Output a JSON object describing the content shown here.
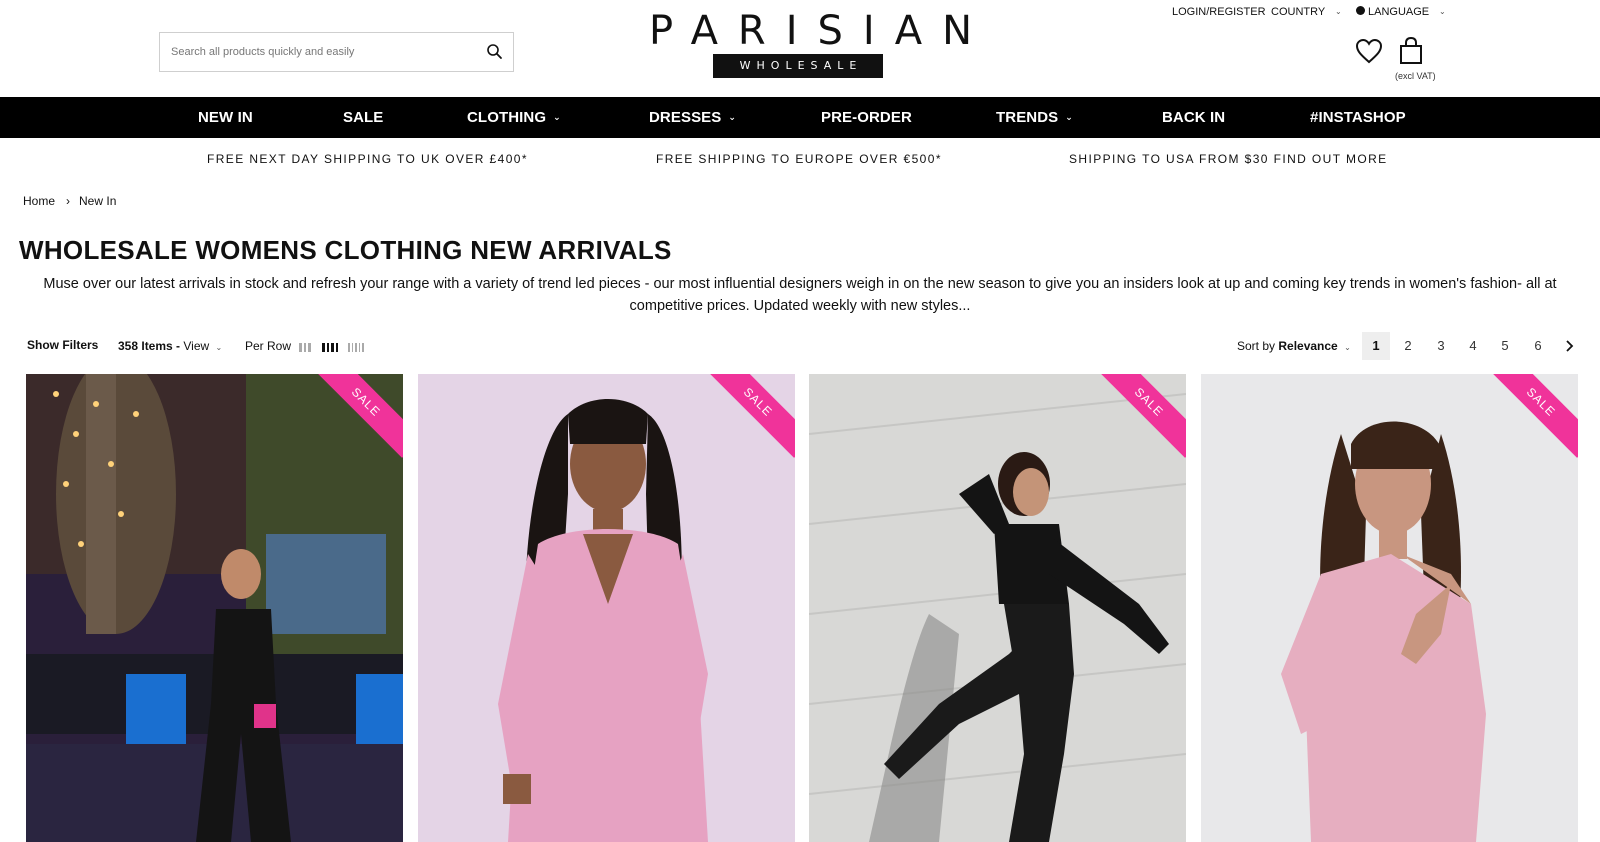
{
  "search": {
    "placeholder": "Search all products quickly and easily"
  },
  "logo": {
    "top": "PARISIAN",
    "bottom": "WHOLESALE"
  },
  "top_links": {
    "login": "LOGIN/REGISTER",
    "country": "COUNTRY",
    "language": "LANGUAGE"
  },
  "cart": {
    "vat_note": "(excl VAT)"
  },
  "icons": {
    "search": "search-icon",
    "wishlist": "heart-icon",
    "bag": "shopping-bag-icon",
    "globe": "globe-icon",
    "next": "chevron-right-icon"
  },
  "nav": {
    "items": [
      {
        "label": "NEW IN",
        "dropdown": false
      },
      {
        "label": "SALE",
        "dropdown": false
      },
      {
        "label": "CLOTHING",
        "dropdown": true
      },
      {
        "label": "DRESSES",
        "dropdown": true
      },
      {
        "label": "PRE-ORDER",
        "dropdown": false
      },
      {
        "label": "TRENDS",
        "dropdown": true
      },
      {
        "label": "BACK IN",
        "dropdown": false
      },
      {
        "label": "#INSTASHOP",
        "dropdown": false
      }
    ]
  },
  "shipping": {
    "uk": "FREE NEXT DAY SHIPPING TO UK OVER £400*",
    "europe": "FREE SHIPPING TO EUROPE OVER €500*",
    "usa": "SHIPPING TO USA FROM $30 FIND OUT MORE"
  },
  "breadcrumb": {
    "home": "Home",
    "separator": "›",
    "current": "New In"
  },
  "page": {
    "title": "WHOLESALE WOMENS CLOTHING NEW ARRIVALS",
    "description": "Muse over our latest arrivals in stock and refresh your range with a variety of trend led pieces - our most influential designers weigh in on the new season to give you an insiders look at up and coming key trends in women's fashion- all at competitive prices. Updated weekly with new styles..."
  },
  "toolbar": {
    "show_filters": "Show Filters",
    "items_count": "358 Items -",
    "view": "View",
    "per_row": "Per Row",
    "sort_label": "Sort by",
    "sort_value": "Relevance",
    "pages": [
      "1",
      "2",
      "3",
      "4",
      "5",
      "6"
    ],
    "active_page": "1"
  },
  "products": [
    {
      "badge": "SALE"
    },
    {
      "badge": "SALE"
    },
    {
      "badge": "SALE"
    },
    {
      "badge": "SALE"
    }
  ],
  "colors": {
    "accent_pink": "#f0339a",
    "nav_bg": "#000000"
  }
}
